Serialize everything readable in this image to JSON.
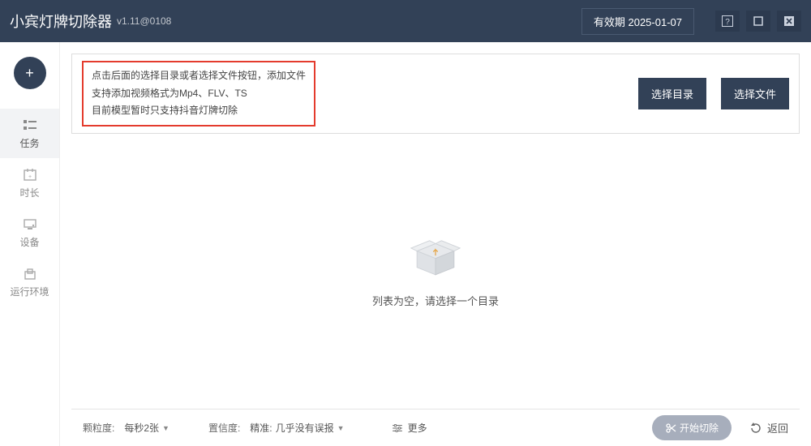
{
  "titlebar": {
    "app_title": "小宾灯牌切除器",
    "app_version": "v1.11@0108",
    "expiry_label": "有效期 2025-01-07"
  },
  "fab": {
    "label": "+"
  },
  "sidebar": {
    "items": [
      {
        "label": "任务"
      },
      {
        "label": "时长"
      },
      {
        "label": "设备"
      },
      {
        "label": "运行环境"
      }
    ]
  },
  "info": {
    "line1": "点击后面的选择目录或者选择文件按钮，添加文件",
    "line2": "支持添加视频格式为Mp4、FLV、TS",
    "line3": "目前模型暂时只支持抖音灯牌切除",
    "select_dir": "选择目录",
    "select_file": "选择文件"
  },
  "empty": {
    "text": "列表为空，请选择一个目录"
  },
  "bottom": {
    "grain_label": "颗粒度:",
    "grain_value": "每秒2张",
    "conf_label": "置信度:",
    "conf_prefix": "精准:",
    "conf_value": "几乎没有误报",
    "more_label": "更多",
    "start_label": "开始切除",
    "back_label": "返回"
  }
}
